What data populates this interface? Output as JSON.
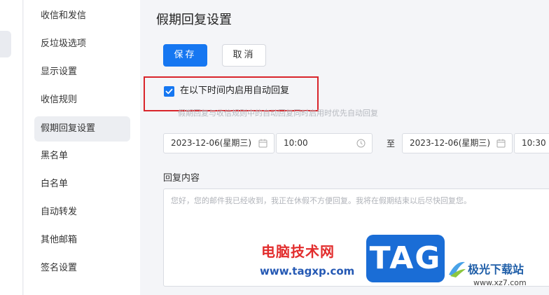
{
  "sidebar": {
    "items": [
      {
        "label": "收信和发信",
        "active": false
      },
      {
        "label": "反垃圾选项",
        "active": false
      },
      {
        "label": "显示设置",
        "active": false
      },
      {
        "label": "收信规则",
        "active": false
      },
      {
        "label": "假期回复设置",
        "active": true
      },
      {
        "label": "黑名单",
        "active": false
      },
      {
        "label": "白名单",
        "active": false
      },
      {
        "label": "自动转发",
        "active": false
      },
      {
        "label": "其他邮箱",
        "active": false
      },
      {
        "label": "签名设置",
        "active": false
      }
    ]
  },
  "main": {
    "title": "假期回复设置",
    "save_label": "保存",
    "cancel_label": "取消",
    "enable_label": "在以下时间内启用自动回复",
    "enable_checked": true,
    "hint": "假期回复与收信规则中的自动回复同时启用时优先自动回复",
    "start_date": "2023-12-06(星期三)",
    "start_time": "10:00",
    "to_label": "至",
    "end_date": "2023-12-06(星期三)",
    "end_time": "10:30",
    "content_label": "回复内容",
    "content_text": "您好，您的邮件我已经收到，我正在休假不方便回复。我将在假期结束以后尽快回复您。"
  },
  "watermark": {
    "site_cn": "电脑技术网",
    "site_url": "www.tagxp.com",
    "badge": "TAG",
    "jiguang_cn": "极光下载站",
    "jiguang_url": "www.xz7.com"
  },
  "colors": {
    "accent": "#1677f1",
    "highlight_border": "#d9252b",
    "watermark_red": "#e22d2d",
    "watermark_blue": "#2559b4"
  },
  "icons": {
    "checkbox": "check-icon",
    "date": "calendar-icon",
    "time": "clock-icon"
  }
}
